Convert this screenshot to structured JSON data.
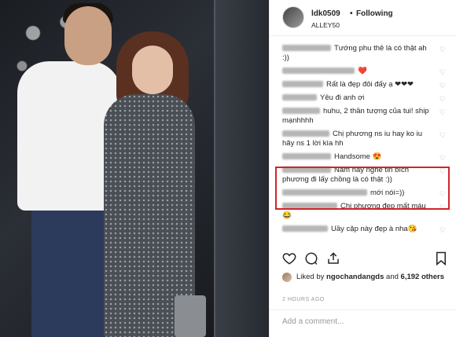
{
  "header": {
    "username": "ldk0509",
    "separator": "•",
    "follow_status": "Following",
    "location": "ALLEY50"
  },
  "comments": [
    {
      "text": "Tướng phu thê là có thật ah :))",
      "blur_width": 62
    },
    {
      "text": "❤️",
      "blur_width": 92
    },
    {
      "text": "Rất là đẹp đôi đấy ạ ❤❤❤",
      "blur_width": 52
    },
    {
      "text": "Yêu đi anh ơi",
      "blur_width": 44
    },
    {
      "text": "huhu, 2 thần tượng của tui! ship mạnhhhh",
      "blur_width": 48
    },
    {
      "text": "Chị phương ns iu hay ko iu hãy ns 1 lời kìa hh",
      "blur_width": 60
    },
    {
      "text": "Handsome 😍",
      "blur_width": 62
    },
    {
      "text": "Năm nay nghe tin bích phương đi lấy chồng là có thật :))",
      "blur_width": 62
    },
    {
      "text": "mới nói=))",
      "blur_width": 108
    },
    {
      "text": "Chị phương đẹp mất máu😂",
      "blur_width": 70
    },
    {
      "text": "Uầy cặp này đẹp à nha😘",
      "blur_width": 58
    }
  ],
  "likes": {
    "prefix": "Liked by",
    "user": "ngochandangds",
    "conj": "and",
    "count": "6,192 others"
  },
  "timestamp": "2 HOURS AGO",
  "add_comment": {
    "placeholder": "Add a comment..."
  },
  "highlight_color": "#d0252b"
}
